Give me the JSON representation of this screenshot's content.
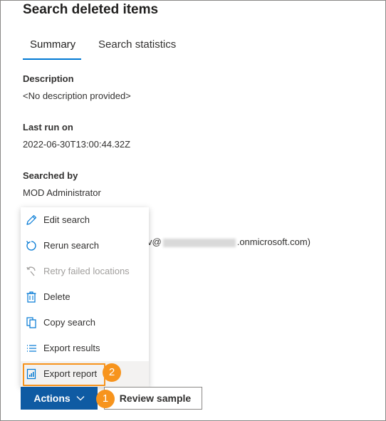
{
  "panel": {
    "title": "Search deleted items"
  },
  "tabs": [
    {
      "label": "Summary",
      "selected": true
    },
    {
      "label": "Search statistics",
      "selected": false
    }
  ],
  "details": {
    "description_label": "Description",
    "description_value": "<No description provided>",
    "last_run_label": "Last run on",
    "last_run_value": "2022-06-30T13:00:44.32Z",
    "searched_by_label": "Searched by",
    "searched_by_value": "MOD Administrator",
    "email_prefix": "v@",
    "email_suffix": ".onmicrosoft.com)"
  },
  "menu": {
    "items": [
      {
        "label": "Edit search",
        "icon": "pencil-icon",
        "disabled": false
      },
      {
        "label": "Rerun search",
        "icon": "refresh-icon",
        "disabled": false
      },
      {
        "label": "Retry failed locations",
        "icon": "retry-icon",
        "disabled": true
      },
      {
        "label": "Delete",
        "icon": "trash-icon",
        "disabled": false
      },
      {
        "label": "Copy search",
        "icon": "copy-icon",
        "disabled": false
      },
      {
        "label": "Export results",
        "icon": "list-icon",
        "disabled": false
      },
      {
        "label": "Export report",
        "icon": "report-icon",
        "disabled": false,
        "hovered": true
      }
    ]
  },
  "buttons": {
    "actions_label": "Actions",
    "review_label": "Review sample"
  },
  "callouts": {
    "step1": "1",
    "step2": "2"
  },
  "colors": {
    "accent": "#0078d4",
    "primary_button": "#0f5ba3",
    "callout": "#f7941d"
  }
}
